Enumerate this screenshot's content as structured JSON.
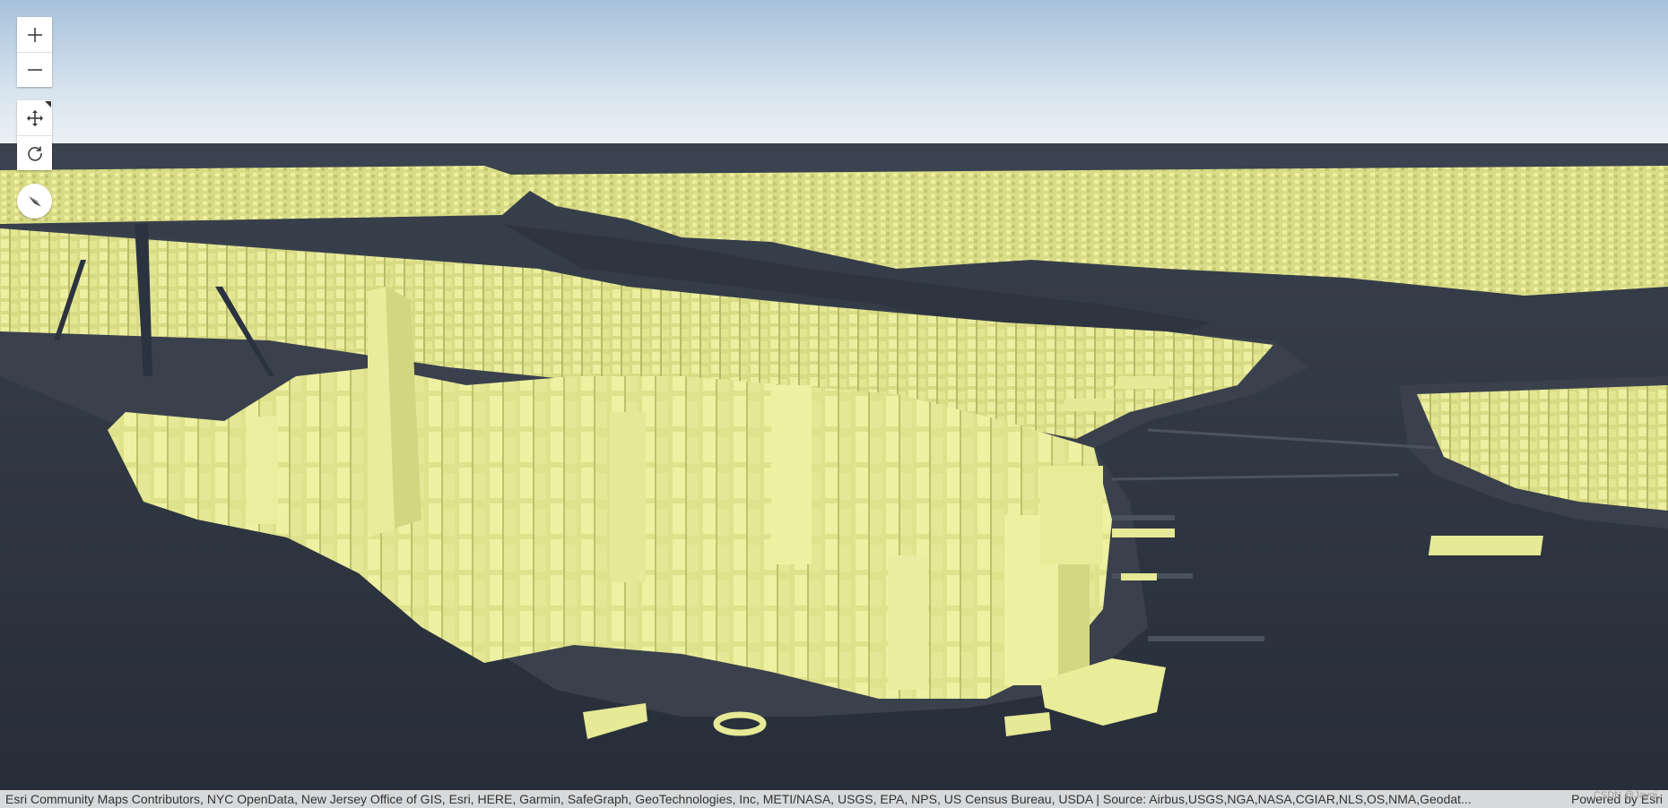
{
  "map": {
    "controls": {
      "zoom_in_icon": "plus-icon",
      "zoom_out_icon": "minus-icon",
      "pan_icon": "move-arrows-icon",
      "rotate_icon": "rotate-icon",
      "compass_icon": "compass-needle-icon"
    },
    "colors": {
      "sky_top": "#a9c4dc",
      "sky_horizon": "#e4edf3",
      "ground": "#2b3340",
      "land": "#3a414c",
      "building": "#e8eb96",
      "building_shadow": "#c5c86e"
    }
  },
  "attribution": {
    "text": "Esri Community Maps Contributors, NYC OpenData, New Jersey Office of GIS, Esri, HERE, Garmin, SafeGraph, GeoTechnologies, Inc, METI/NASA, USGS, EPA, NPS, US Census Bureau, USDA | Source: Airbus,USGS,NGA,NASA,CGIAR,NLS,OS,NMA,Geodat...",
    "powered_by": "Powered by Esri"
  },
  "watermark": "CSDN @Jayqi"
}
